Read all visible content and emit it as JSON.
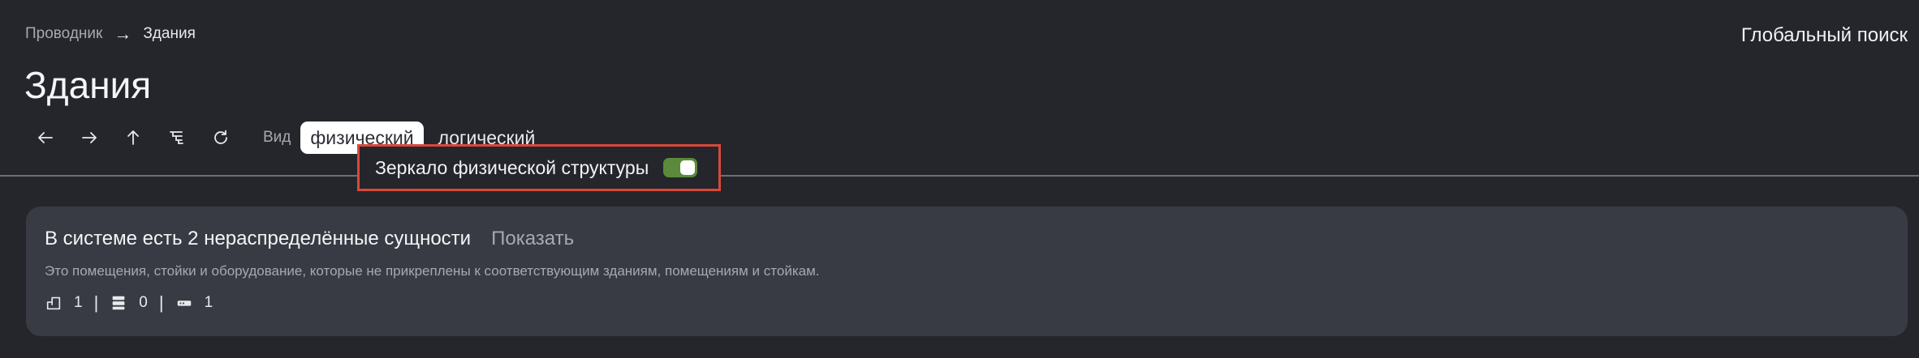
{
  "breadcrumb": {
    "root": "Проводник",
    "arrow": "→",
    "current": "Здания"
  },
  "header": {
    "global_search": "Глобальный поиск",
    "title": "Здания"
  },
  "toolbar": {
    "buttons": [
      {
        "icon": "arrow-left-icon"
      },
      {
        "icon": "arrow-right-icon"
      },
      {
        "icon": "arrow-up-icon"
      },
      {
        "icon": "tree-view-icon"
      },
      {
        "icon": "refresh-icon"
      }
    ],
    "view_label": "Вид",
    "views": [
      "физический",
      "логический"
    ],
    "active_view": "физический"
  },
  "mirror": {
    "label": "Зеркало физической структуры",
    "enabled": true,
    "toggle_color": "#5b8a3a"
  },
  "card": {
    "title": "В системе есть 2 нераспределённые сущности",
    "show_label": "Показать",
    "description": "Это помещения, стойки и оборудование, которые не прикреплены к соответствующим зданиям, помещениям и стойкам.",
    "counts": [
      {
        "icon": "room-icon",
        "value": "1"
      },
      {
        "icon": "rack-icon",
        "value": "0"
      },
      {
        "icon": "device-icon",
        "value": "1"
      }
    ],
    "separator": "|"
  },
  "colors": {
    "background": "#24262c",
    "card": "#383b43",
    "highlight_border": "#d9483b"
  }
}
